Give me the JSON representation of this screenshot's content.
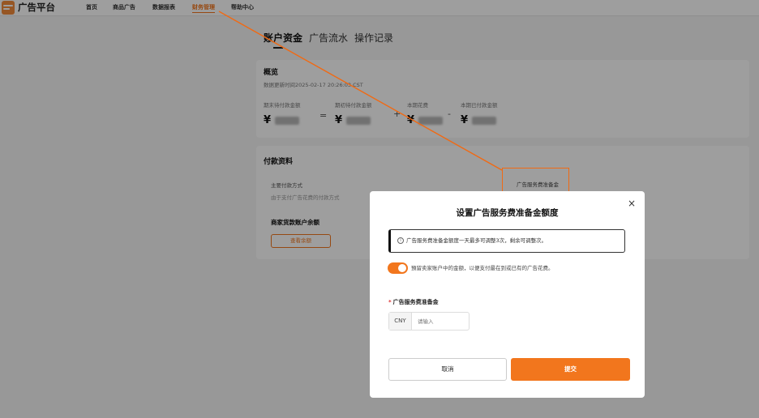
{
  "app": {
    "brand": "广告平台"
  },
  "nav": [
    "首页",
    "商品广告",
    "数据报表",
    "财务管理",
    "帮助中心"
  ],
  "tabs": [
    "账户资金",
    "广告流水",
    "操作记录"
  ],
  "overview": {
    "title": "概览",
    "updated": "数据更新时间2025-02-17 20:26:03 CST",
    "metrics": [
      {
        "label": "期末待付款金额",
        "currency": "¥"
      },
      {
        "label": "期初待付款金额",
        "currency": "¥"
      },
      {
        "label": "本期花费",
        "currency": "¥"
      },
      {
        "label": "本期已付款金额",
        "currency": "¥"
      }
    ],
    "operators": [
      "=",
      "+",
      "-"
    ]
  },
  "payment": {
    "title": "付款资料",
    "method_label": "主要付款方式",
    "method_desc": "由于支付广告花费的付款方式",
    "balance_label": "商家货款账户余额",
    "balance_button": "查看余额",
    "reserve_link": "广告服务费准备金"
  },
  "dialog": {
    "title": "设置广告服务费准备金额度",
    "close": "×",
    "notice_icon": "i",
    "notice": "广告服务费准备金额度一天最多可调整3次，剩余可调整次。",
    "toggle_text": "預留卖家账户中的金额，以便支付最在到或已有的广告花费。",
    "toggle_on": true,
    "field_label": "广告服务费准备金",
    "required_mark": "*",
    "currency": "CNY",
    "placeholder": "请输入",
    "cancel": "取消",
    "submit": "提交"
  },
  "colors": {
    "accent": "#f2761d",
    "annotation": "#f06a14"
  }
}
